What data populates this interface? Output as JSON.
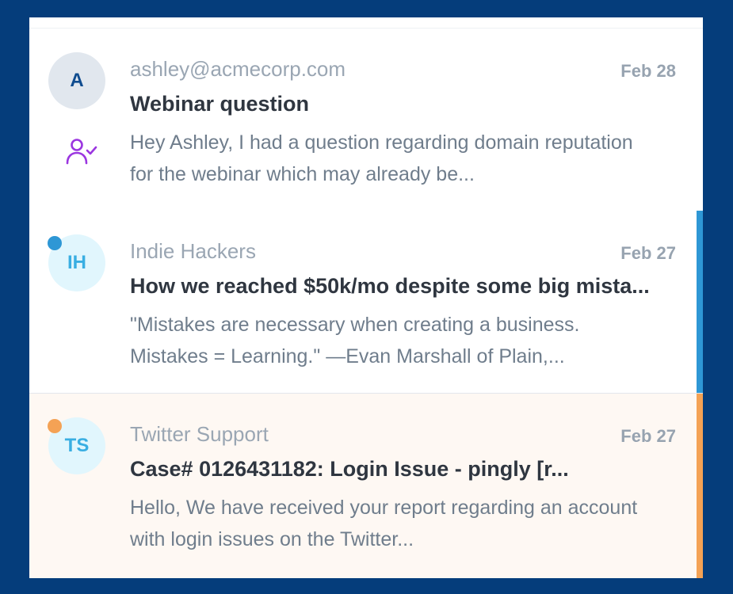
{
  "messages": [
    {
      "avatar_initials": "A",
      "avatar_bg": "#e1e7ee",
      "avatar_fg": "#0f4c8f",
      "from": "ashley@acmecorp.com",
      "date": "Feb 28",
      "subject": "Webinar question",
      "preview": "Hey Ashley, I had a question regarding domain reputation for the webinar which may already be...",
      "status_icon": "user-check-icon",
      "status_icon_color": "#9b36e0",
      "unread": false,
      "accent_color": null
    },
    {
      "avatar_initials": "IH",
      "avatar_bg": "#e1f6fd",
      "avatar_fg": "#39aee2",
      "from": "Indie Hackers",
      "date": "Feb 27",
      "subject": "How we reached $50k/mo despite some big mista...",
      "preview": "\"Mistakes are necessary when creating a business. Mistakes = Learning.\" —Evan Marshall of Plain,...",
      "unread": true,
      "unread_color": "#2e97d5",
      "accent_color": "#2e97d5"
    },
    {
      "avatar_initials": "TS",
      "avatar_bg": "#e1f6fd",
      "avatar_fg": "#39aee2",
      "from": "Twitter Support",
      "date": "Feb 27",
      "subject": "Case# 0126431182: Login Issue - pingly [r...",
      "preview": "Hello, We have received your report regarding an account with login issues on the Twitter...",
      "unread": true,
      "unread_color": "#f4a255",
      "accent_color": "#f4a255"
    }
  ]
}
